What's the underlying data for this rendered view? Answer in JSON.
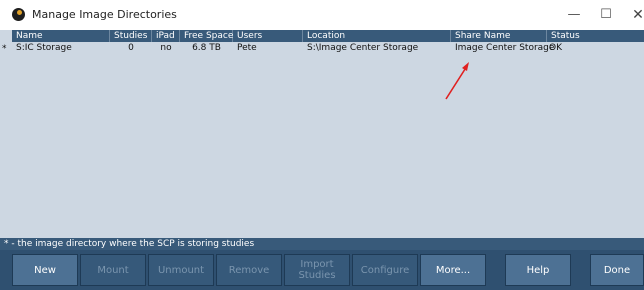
{
  "window": {
    "title": "Manage Image Directories",
    "minimize_glyph": "—",
    "maximize_glyph": "☐",
    "close_glyph": "✕"
  },
  "table": {
    "columns": [
      "Name",
      "Studies",
      "iPad",
      "Free Space",
      "Users",
      "Location",
      "Share Name",
      "Status"
    ],
    "rows": [
      {
        "marker": "*",
        "name": "S:IC Storage",
        "studies": "0",
        "ipad": "no",
        "free_space": "6.8 TB",
        "users": "Pete",
        "location": "S:\\Image Center Storage",
        "share_name": "Image Center Storage",
        "status": "OK"
      }
    ]
  },
  "footer_note": "* - the image directory where the SCP is storing studies",
  "buttons": [
    {
      "label": "New",
      "enabled": true
    },
    {
      "label": "Mount",
      "enabled": false
    },
    {
      "label": "Unmount",
      "enabled": false
    },
    {
      "label": "Remove",
      "enabled": false
    },
    {
      "label": "Import\nStudies",
      "enabled": false
    },
    {
      "label": "Configure",
      "enabled": false
    },
    {
      "label": "More...",
      "enabled": true
    },
    {
      "label": "Help",
      "enabled": true
    },
    {
      "label": "Done",
      "enabled": true
    }
  ],
  "colors": {
    "header_bg": "#385a7a",
    "list_bg": "#cdd7e2",
    "buttonbar_bg": "#2f5070",
    "annotation_arrow": "#e02020"
  },
  "annotation": {
    "icon": "red-arrow-icon"
  }
}
